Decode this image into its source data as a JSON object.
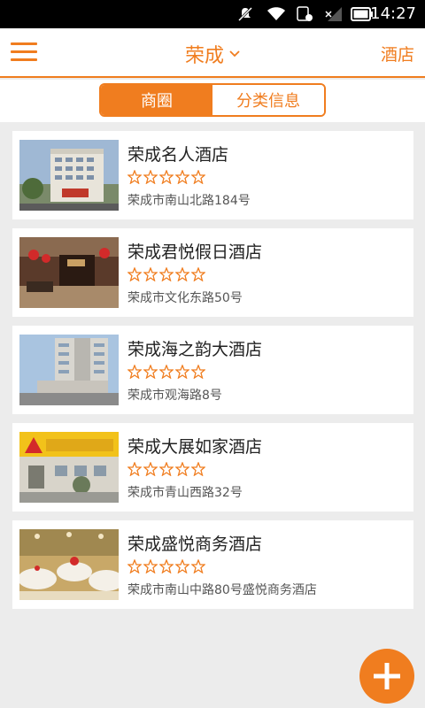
{
  "status_bar": {
    "time": "14:27",
    "icons": [
      "mute-icon",
      "wifi-icon",
      "sim-icon",
      "signal-icon",
      "battery-icon"
    ]
  },
  "header": {
    "menu_icon": "hamburger-icon",
    "city": "荣成",
    "city_dropdown_icon": "chevron-down-icon",
    "right_label": "酒店"
  },
  "tabs": {
    "items": [
      {
        "label": "商圈",
        "active": true
      },
      {
        "label": "分类信息",
        "active": false
      }
    ]
  },
  "hotels": [
    {
      "name": "荣成名人酒店",
      "address": "荣成市南山北路184号",
      "rating": 0,
      "max_rating": 5
    },
    {
      "name": "荣成君悦假日酒店",
      "address": "荣成市文化东路50号",
      "rating": 0,
      "max_rating": 5
    },
    {
      "name": "荣成海之韵大酒店",
      "address": "荣成市观海路8号",
      "rating": 0,
      "max_rating": 5
    },
    {
      "name": "荣成大展如家酒店",
      "address": "荣成市青山西路32号",
      "rating": 0,
      "max_rating": 5
    },
    {
      "name": "荣成盛悦商务酒店",
      "address": "荣成市南山中路80号盛悦商务酒店",
      "rating": 0,
      "max_rating": 5
    }
  ],
  "fab": {
    "icon": "plus-icon"
  },
  "colors": {
    "accent": "#f07d1f",
    "background": "#ececec",
    "card": "#ffffff"
  }
}
